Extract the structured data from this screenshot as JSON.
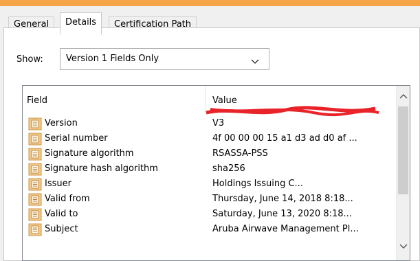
{
  "tabs": [
    {
      "label": "General"
    },
    {
      "label": "Details"
    },
    {
      "label": "Certification Path"
    }
  ],
  "show": {
    "label": "Show:",
    "selected": "Version 1 Fields Only"
  },
  "list": {
    "columns": {
      "field": "Field",
      "value": "Value"
    },
    "rows": [
      {
        "field": "Version",
        "value": "V3"
      },
      {
        "field": "Serial number",
        "value": "4f 00 00 00 15 a1 d3 ad d0 af ..."
      },
      {
        "field": "Signature algorithm",
        "value": "RSASSA-PSS"
      },
      {
        "field": "Signature hash algorithm",
        "value": "sha256"
      },
      {
        "field": "Issuer",
        "value": "Holdings Issuing C..."
      },
      {
        "field": "Valid from",
        "value": "Thursday, June 14, 2018 8:18..."
      },
      {
        "field": "Valid to",
        "value": "Saturday, June 13, 2020 8:18..."
      },
      {
        "field": "Subject",
        "value": "Aruba Airwave Management Pl..."
      }
    ]
  },
  "colors": {
    "title_accent": "#f7a54a",
    "icon_fill": "#f3c989",
    "redaction": "#e8242a"
  },
  "icons": {
    "row_icon": "certificate-field-icon",
    "dropdown": "chevron-down-icon",
    "scroll_up": "chevron-up-icon",
    "scroll_down": "chevron-down-icon"
  }
}
